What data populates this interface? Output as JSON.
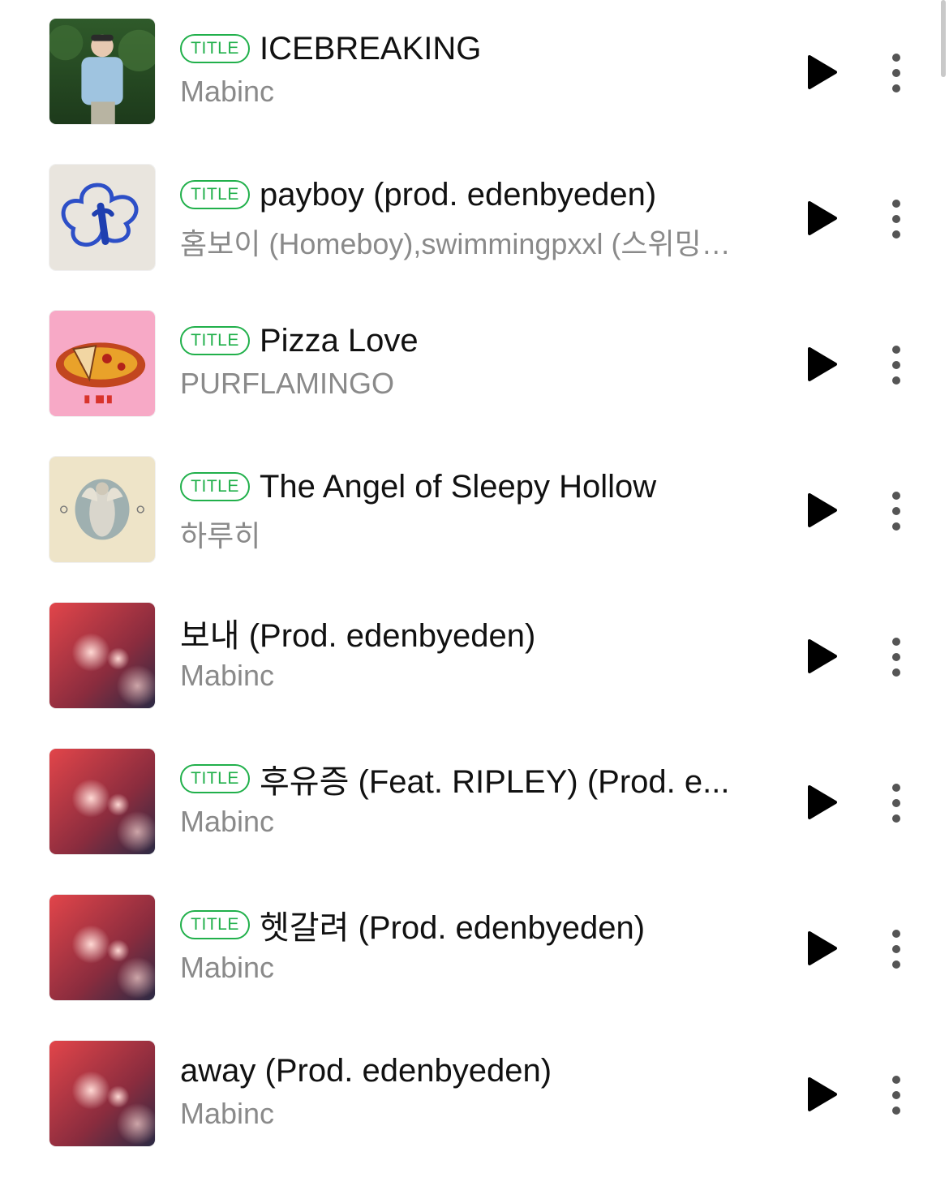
{
  "tracks": [
    {
      "is_title": true,
      "badge": "TITLE",
      "title": "ICEBREAKING",
      "artist": "Mabinc",
      "art": "portrait-art"
    },
    {
      "is_title": true,
      "badge": "TITLE",
      "title": "payboy (prod. edenbyeden)",
      "artist": "홈보이 (Homeboy),swimmingpxxl (스위밍…",
      "art": "blue-doodle-art"
    },
    {
      "is_title": true,
      "badge": "TITLE",
      "title": "Pizza Love",
      "artist": "PURFLAMINGO",
      "art": "pizza-art"
    },
    {
      "is_title": true,
      "badge": "TITLE",
      "title": "The Angel of Sleepy Hollow",
      "artist": "하루히",
      "art": "angel-art"
    },
    {
      "is_title": false,
      "badge": "",
      "title": "보내 (Prod. edenbyeden)",
      "artist": "Mabinc",
      "art": "bokeh-art"
    },
    {
      "is_title": true,
      "badge": "TITLE",
      "title": "후유증 (Feat. RIPLEY) (Prod. e...",
      "artist": "Mabinc",
      "art": "bokeh-art"
    },
    {
      "is_title": true,
      "badge": "TITLE",
      "title": "헷갈려 (Prod. edenbyeden)",
      "artist": "Mabinc",
      "art": "bokeh-art"
    },
    {
      "is_title": false,
      "badge": "",
      "title": "away (Prod. edenbyeden)",
      "artist": "Mabinc",
      "art": "bokeh-art"
    }
  ],
  "icons": {
    "play": "play-icon",
    "more": "more-vertical-icon"
  },
  "colors": {
    "title_badge": "#21b04b",
    "artist_text": "#8a8a8a",
    "title_text": "#111111",
    "icon": "#000000"
  }
}
